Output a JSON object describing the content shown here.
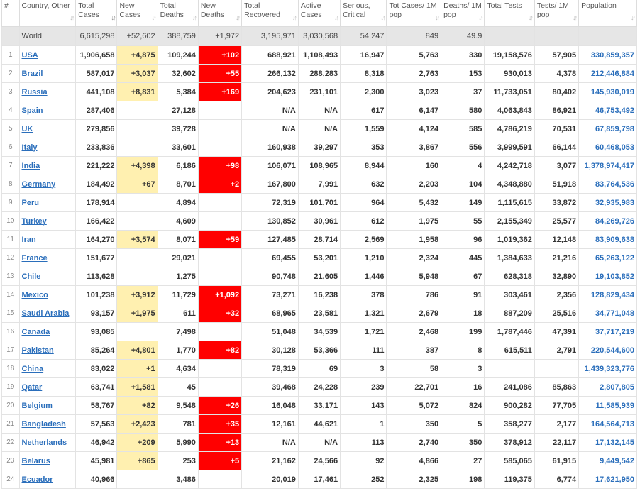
{
  "headers": [
    {
      "key": "idx",
      "label": "#"
    },
    {
      "key": "country",
      "label": "Country, Other"
    },
    {
      "key": "total_cases",
      "label": "Total Cases"
    },
    {
      "key": "new_cases",
      "label": "New Cases"
    },
    {
      "key": "total_deaths",
      "label": "Total Deaths"
    },
    {
      "key": "new_deaths",
      "label": "New Deaths"
    },
    {
      "key": "total_recovered",
      "label": "Total Recovered"
    },
    {
      "key": "active_cases",
      "label": "Active Cases"
    },
    {
      "key": "serious",
      "label": "Serious, Critical"
    },
    {
      "key": "cases_per_m",
      "label": "Tot Cases/ 1M pop"
    },
    {
      "key": "deaths_per_m",
      "label": "Deaths/ 1M pop"
    },
    {
      "key": "total_tests",
      "label": "Total Tests"
    },
    {
      "key": "tests_per_m",
      "label": "Tests/ 1M pop"
    },
    {
      "key": "population",
      "label": "Population"
    }
  ],
  "sort_glyph": "↓↑",
  "world": {
    "idx": "",
    "country": "World",
    "total_cases": "6,615,298",
    "new_cases": "+52,602",
    "total_deaths": "388,759",
    "new_deaths": "+1,972",
    "total_recovered": "3,195,971",
    "active_cases": "3,030,568",
    "serious": "54,247",
    "cases_per_m": "849",
    "deaths_per_m": "49.9",
    "total_tests": "",
    "tests_per_m": "",
    "population": ""
  },
  "rows": [
    {
      "idx": "1",
      "country": "USA",
      "total_cases": "1,906,658",
      "new_cases": "+4,875",
      "total_deaths": "109,244",
      "new_deaths": "+102",
      "total_recovered": "688,921",
      "active_cases": "1,108,493",
      "serious": "16,947",
      "cases_per_m": "5,763",
      "deaths_per_m": "330",
      "total_tests": "19,158,576",
      "tests_per_m": "57,905",
      "population": "330,859,357"
    },
    {
      "idx": "2",
      "country": "Brazil",
      "total_cases": "587,017",
      "new_cases": "+3,037",
      "total_deaths": "32,602",
      "new_deaths": "+55",
      "total_recovered": "266,132",
      "active_cases": "288,283",
      "serious": "8,318",
      "cases_per_m": "2,763",
      "deaths_per_m": "153",
      "total_tests": "930,013",
      "tests_per_m": "4,378",
      "population": "212,446,884"
    },
    {
      "idx": "3",
      "country": "Russia",
      "total_cases": "441,108",
      "new_cases": "+8,831",
      "total_deaths": "5,384",
      "new_deaths": "+169",
      "total_recovered": "204,623",
      "active_cases": "231,101",
      "serious": "2,300",
      "cases_per_m": "3,023",
      "deaths_per_m": "37",
      "total_tests": "11,733,051",
      "tests_per_m": "80,402",
      "population": "145,930,019"
    },
    {
      "idx": "4",
      "country": "Spain",
      "total_cases": "287,406",
      "new_cases": "",
      "total_deaths": "27,128",
      "new_deaths": "",
      "total_recovered": "N/A",
      "active_cases": "N/A",
      "serious": "617",
      "cases_per_m": "6,147",
      "deaths_per_m": "580",
      "total_tests": "4,063,843",
      "tests_per_m": "86,921",
      "population": "46,753,492"
    },
    {
      "idx": "5",
      "country": "UK",
      "total_cases": "279,856",
      "new_cases": "",
      "total_deaths": "39,728",
      "new_deaths": "",
      "total_recovered": "N/A",
      "active_cases": "N/A",
      "serious": "1,559",
      "cases_per_m": "4,124",
      "deaths_per_m": "585",
      "total_tests": "4,786,219",
      "tests_per_m": "70,531",
      "population": "67,859,798"
    },
    {
      "idx": "6",
      "country": "Italy",
      "total_cases": "233,836",
      "new_cases": "",
      "total_deaths": "33,601",
      "new_deaths": "",
      "total_recovered": "160,938",
      "active_cases": "39,297",
      "serious": "353",
      "cases_per_m": "3,867",
      "deaths_per_m": "556",
      "total_tests": "3,999,591",
      "tests_per_m": "66,144",
      "population": "60,468,053"
    },
    {
      "idx": "7",
      "country": "India",
      "total_cases": "221,222",
      "new_cases": "+4,398",
      "total_deaths": "6,186",
      "new_deaths": "+98",
      "total_recovered": "106,071",
      "active_cases": "108,965",
      "serious": "8,944",
      "cases_per_m": "160",
      "deaths_per_m": "4",
      "total_tests": "4,242,718",
      "tests_per_m": "3,077",
      "population": "1,378,974,417"
    },
    {
      "idx": "8",
      "country": "Germany",
      "total_cases": "184,492",
      "new_cases": "+67",
      "total_deaths": "8,701",
      "new_deaths": "+2",
      "total_recovered": "167,800",
      "active_cases": "7,991",
      "serious": "632",
      "cases_per_m": "2,203",
      "deaths_per_m": "104",
      "total_tests": "4,348,880",
      "tests_per_m": "51,918",
      "population": "83,764,536"
    },
    {
      "idx": "9",
      "country": "Peru",
      "total_cases": "178,914",
      "new_cases": "",
      "total_deaths": "4,894",
      "new_deaths": "",
      "total_recovered": "72,319",
      "active_cases": "101,701",
      "serious": "964",
      "cases_per_m": "5,432",
      "deaths_per_m": "149",
      "total_tests": "1,115,615",
      "tests_per_m": "33,872",
      "population": "32,935,983"
    },
    {
      "idx": "10",
      "country": "Turkey",
      "total_cases": "166,422",
      "new_cases": "",
      "total_deaths": "4,609",
      "new_deaths": "",
      "total_recovered": "130,852",
      "active_cases": "30,961",
      "serious": "612",
      "cases_per_m": "1,975",
      "deaths_per_m": "55",
      "total_tests": "2,155,349",
      "tests_per_m": "25,577",
      "population": "84,269,726"
    },
    {
      "idx": "11",
      "country": "Iran",
      "total_cases": "164,270",
      "new_cases": "+3,574",
      "total_deaths": "8,071",
      "new_deaths": "+59",
      "total_recovered": "127,485",
      "active_cases": "28,714",
      "serious": "2,569",
      "cases_per_m": "1,958",
      "deaths_per_m": "96",
      "total_tests": "1,019,362",
      "tests_per_m": "12,148",
      "population": "83,909,638"
    },
    {
      "idx": "12",
      "country": "France",
      "total_cases": "151,677",
      "new_cases": "",
      "total_deaths": "29,021",
      "new_deaths": "",
      "total_recovered": "69,455",
      "active_cases": "53,201",
      "serious": "1,210",
      "cases_per_m": "2,324",
      "deaths_per_m": "445",
      "total_tests": "1,384,633",
      "tests_per_m": "21,216",
      "population": "65,263,122"
    },
    {
      "idx": "13",
      "country": "Chile",
      "total_cases": "113,628",
      "new_cases": "",
      "total_deaths": "1,275",
      "new_deaths": "",
      "total_recovered": "90,748",
      "active_cases": "21,605",
      "serious": "1,446",
      "cases_per_m": "5,948",
      "deaths_per_m": "67",
      "total_tests": "628,318",
      "tests_per_m": "32,890",
      "population": "19,103,852"
    },
    {
      "idx": "14",
      "country": "Mexico",
      "total_cases": "101,238",
      "new_cases": "+3,912",
      "total_deaths": "11,729",
      "new_deaths": "+1,092",
      "total_recovered": "73,271",
      "active_cases": "16,238",
      "serious": "378",
      "cases_per_m": "786",
      "deaths_per_m": "91",
      "total_tests": "303,461",
      "tests_per_m": "2,356",
      "population": "128,829,434"
    },
    {
      "idx": "15",
      "country": "Saudi Arabia",
      "total_cases": "93,157",
      "new_cases": "+1,975",
      "total_deaths": "611",
      "new_deaths": "+32",
      "total_recovered": "68,965",
      "active_cases": "23,581",
      "serious": "1,321",
      "cases_per_m": "2,679",
      "deaths_per_m": "18",
      "total_tests": "887,209",
      "tests_per_m": "25,516",
      "population": "34,771,048"
    },
    {
      "idx": "16",
      "country": "Canada",
      "total_cases": "93,085",
      "new_cases": "",
      "total_deaths": "7,498",
      "new_deaths": "",
      "total_recovered": "51,048",
      "active_cases": "34,539",
      "serious": "1,721",
      "cases_per_m": "2,468",
      "deaths_per_m": "199",
      "total_tests": "1,787,446",
      "tests_per_m": "47,391",
      "population": "37,717,219"
    },
    {
      "idx": "17",
      "country": "Pakistan",
      "total_cases": "85,264",
      "new_cases": "+4,801",
      "total_deaths": "1,770",
      "new_deaths": "+82",
      "total_recovered": "30,128",
      "active_cases": "53,366",
      "serious": "111",
      "cases_per_m": "387",
      "deaths_per_m": "8",
      "total_tests": "615,511",
      "tests_per_m": "2,791",
      "population": "220,544,600"
    },
    {
      "idx": "18",
      "country": "China",
      "total_cases": "83,022",
      "new_cases": "+1",
      "total_deaths": "4,634",
      "new_deaths": "",
      "total_recovered": "78,319",
      "active_cases": "69",
      "serious": "3",
      "cases_per_m": "58",
      "deaths_per_m": "3",
      "total_tests": "",
      "tests_per_m": "",
      "population": "1,439,323,776"
    },
    {
      "idx": "19",
      "country": "Qatar",
      "total_cases": "63,741",
      "new_cases": "+1,581",
      "total_deaths": "45",
      "new_deaths": "",
      "total_recovered": "39,468",
      "active_cases": "24,228",
      "serious": "239",
      "cases_per_m": "22,701",
      "deaths_per_m": "16",
      "total_tests": "241,086",
      "tests_per_m": "85,863",
      "population": "2,807,805"
    },
    {
      "idx": "20",
      "country": "Belgium",
      "total_cases": "58,767",
      "new_cases": "+82",
      "total_deaths": "9,548",
      "new_deaths": "+26",
      "total_recovered": "16,048",
      "active_cases": "33,171",
      "serious": "143",
      "cases_per_m": "5,072",
      "deaths_per_m": "824",
      "total_tests": "900,282",
      "tests_per_m": "77,705",
      "population": "11,585,939"
    },
    {
      "idx": "21",
      "country": "Bangladesh",
      "total_cases": "57,563",
      "new_cases": "+2,423",
      "total_deaths": "781",
      "new_deaths": "+35",
      "total_recovered": "12,161",
      "active_cases": "44,621",
      "serious": "1",
      "cases_per_m": "350",
      "deaths_per_m": "5",
      "total_tests": "358,277",
      "tests_per_m": "2,177",
      "population": "164,564,713"
    },
    {
      "idx": "22",
      "country": "Netherlands",
      "total_cases": "46,942",
      "new_cases": "+209",
      "total_deaths": "5,990",
      "new_deaths": "+13",
      "total_recovered": "N/A",
      "active_cases": "N/A",
      "serious": "113",
      "cases_per_m": "2,740",
      "deaths_per_m": "350",
      "total_tests": "378,912",
      "tests_per_m": "22,117",
      "population": "17,132,145"
    },
    {
      "idx": "23",
      "country": "Belarus",
      "total_cases": "45,981",
      "new_cases": "+865",
      "total_deaths": "253",
      "new_deaths": "+5",
      "total_recovered": "21,162",
      "active_cases": "24,566",
      "serious": "92",
      "cases_per_m": "4,866",
      "deaths_per_m": "27",
      "total_tests": "585,065",
      "tests_per_m": "61,915",
      "population": "9,449,542"
    },
    {
      "idx": "24",
      "country": "Ecuador",
      "total_cases": "40,966",
      "new_cases": "",
      "total_deaths": "3,486",
      "new_deaths": "",
      "total_recovered": "20,019",
      "active_cases": "17,461",
      "serious": "252",
      "cases_per_m": "2,325",
      "deaths_per_m": "198",
      "total_tests": "119,375",
      "tests_per_m": "6,774",
      "population": "17,621,950"
    }
  ]
}
